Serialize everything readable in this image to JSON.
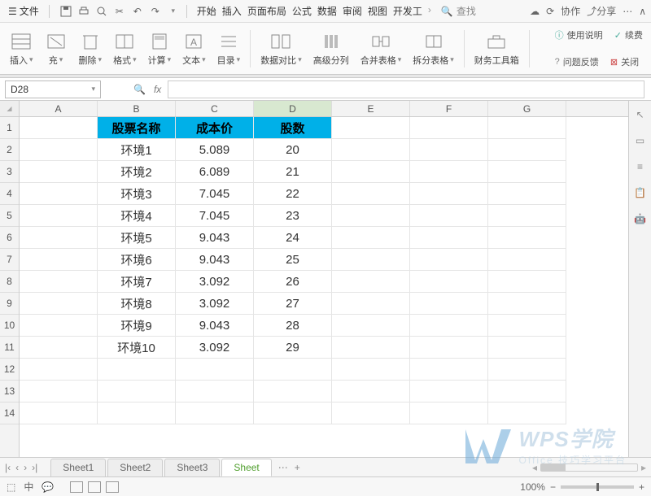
{
  "menubar": {
    "file": "文件",
    "search": "查找",
    "collab": "协作",
    "share": "分享"
  },
  "tabs": [
    "开始",
    "插入",
    "页面布局",
    "公式",
    "数据",
    "审阅",
    "视图",
    "开发工"
  ],
  "ribbon": {
    "insert": "插入",
    "fill": "充",
    "delete": "删除",
    "format": "格式",
    "calc": "计算",
    "text": "文本",
    "toc": "目录",
    "compare": "数据对比",
    "advsort": "高级分列",
    "merge": "合并表格",
    "split": "拆分表格",
    "fintool": "财务工具箱",
    "help": "使用说明",
    "cont": "续费",
    "feedback": "问题反馈",
    "close": "关闭"
  },
  "namebox": "D28",
  "columns": [
    "A",
    "B",
    "C",
    "D",
    "E",
    "F",
    "G"
  ],
  "rows": [
    "1",
    "2",
    "3",
    "4",
    "5",
    "6",
    "7",
    "8",
    "9",
    "10",
    "11",
    "12",
    "13",
    "14"
  ],
  "headers": {
    "b": "股票名称",
    "c": "成本价",
    "d": "股数"
  },
  "chart_data": {
    "type": "table",
    "columns": [
      "股票名称",
      "成本价",
      "股数"
    ],
    "rows": [
      {
        "name": "环境1",
        "cost": "5.089",
        "qty": "20"
      },
      {
        "name": "环境2",
        "cost": "6.089",
        "qty": "21"
      },
      {
        "name": "环境3",
        "cost": "7.045",
        "qty": "22"
      },
      {
        "name": "环境4",
        "cost": "7.045",
        "qty": "23"
      },
      {
        "name": "环境5",
        "cost": "9.043",
        "qty": "24"
      },
      {
        "name": "环境6",
        "cost": "9.043",
        "qty": "25"
      },
      {
        "name": "环境7",
        "cost": "3.092",
        "qty": "26"
      },
      {
        "name": "环境8",
        "cost": "3.092",
        "qty": "27"
      },
      {
        "name": "环境9",
        "cost": "9.043",
        "qty": "28"
      },
      {
        "name": "环境10",
        "cost": "3.092",
        "qty": "29"
      }
    ]
  },
  "sheets": [
    "Sheet1",
    "Sheet2",
    "Sheet3",
    "Sheet"
  ],
  "active_sheet": 3,
  "zoom": "100%",
  "watermark": {
    "brand": "WPS学院",
    "sub": "Office 技巧学习平台"
  }
}
